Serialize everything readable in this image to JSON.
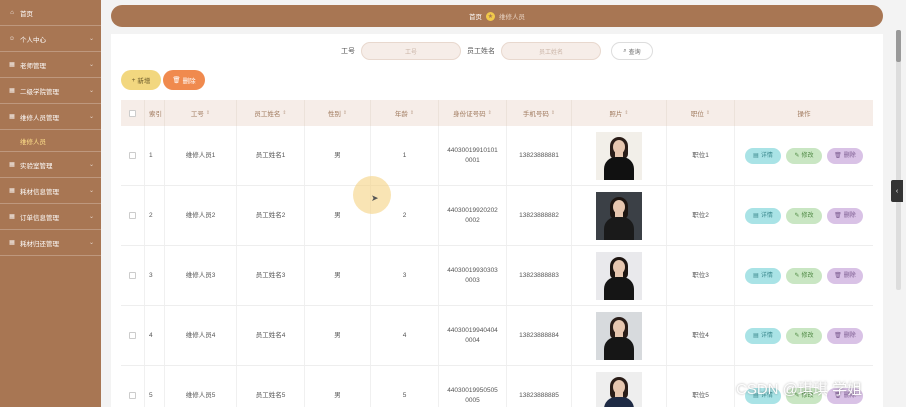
{
  "sidebar": {
    "items": [
      {
        "label": "首页",
        "icon": "home-icon",
        "arrow": false
      },
      {
        "label": "个人中心",
        "icon": "user-icon",
        "arrow": true
      },
      {
        "label": "老师管理",
        "icon": "grid-icon",
        "arrow": true
      },
      {
        "label": "二级学院管理",
        "icon": "grid-icon",
        "arrow": true
      },
      {
        "label": "维修人员管理",
        "icon": "grid-icon",
        "arrow": true
      },
      {
        "label": "实验室管理",
        "icon": "grid-icon",
        "arrow": true
      },
      {
        "label": "耗材信息管理",
        "icon": "grid-icon",
        "arrow": true
      },
      {
        "label": "订单信息管理",
        "icon": "grid-icon",
        "arrow": true
      },
      {
        "label": "耗材归还管理",
        "icon": "grid-icon",
        "arrow": true
      }
    ],
    "active_sub": "维修人员"
  },
  "breadcrumb": {
    "home": "首页",
    "current": "维修人员"
  },
  "search": {
    "label1": "工号",
    "placeholder1": "工号",
    "label2": "员工姓名",
    "placeholder2": "员工姓名",
    "button": "查询"
  },
  "actions": {
    "add": "新增",
    "delete": "删除"
  },
  "table": {
    "headers": [
      "索引",
      "工号",
      "员工姓名",
      "性别",
      "年龄",
      "身份证号码",
      "手机号码",
      "照片",
      "职位",
      "操作"
    ],
    "rows": [
      {
        "idx": "1",
        "gh": "维修人员1",
        "xm": "员工姓名1",
        "xb": "男",
        "nl": "1",
        "sf1": "44030019910101",
        "sf2": "0001",
        "sj": "13823888881",
        "zw": "职位1",
        "photo_bg": "#f2efe9",
        "photo_body": "#111111",
        "photo_hair": "#2a1d18"
      },
      {
        "idx": "2",
        "gh": "维修人员2",
        "xm": "员工姓名2",
        "xb": "男",
        "nl": "2",
        "sf1": "44030019920202",
        "sf2": "0002",
        "sj": "13823888882",
        "zw": "职位2",
        "photo_bg": "#3b4046",
        "photo_body": "#1a1a1a",
        "photo_hair": "#1e1612"
      },
      {
        "idx": "3",
        "gh": "维修人员3",
        "xm": "员工姓名3",
        "xb": "男",
        "nl": "3",
        "sf1": "44030019930303",
        "sf2": "0003",
        "sj": "13823888883",
        "zw": "职位3",
        "photo_bg": "#e9e9ec",
        "photo_body": "#151515",
        "photo_hair": "#1e1612"
      },
      {
        "idx": "4",
        "gh": "维修人员4",
        "xm": "员工姓名4",
        "xb": "男",
        "nl": "4",
        "sf1": "44030019940404",
        "sf2": "0004",
        "sj": "13823888884",
        "zw": "职位4",
        "photo_bg": "#d7dadd",
        "photo_body": "#161616",
        "photo_hair": "#2a1d18"
      },
      {
        "idx": "5",
        "gh": "维修人员5",
        "xm": "员工姓名5",
        "xb": "男",
        "nl": "5",
        "sf1": "44030019950505",
        "sf2": "0005",
        "sj": "13823888885",
        "zw": "职位5",
        "photo_bg": "#eeeeee",
        "photo_body": "#1e2a44",
        "photo_hair": "#2a1d18"
      }
    ],
    "ops": {
      "detail": "详情",
      "edit": "修改",
      "delete": "删除"
    }
  },
  "watermark": "CSDN @琪琪 学姐",
  "colors": {
    "sidebar": "#a87653",
    "header_bg": "#f6ede8",
    "detail": "#a9e3e6",
    "edit": "#c9e6c3",
    "remove": "#d9c2e6"
  }
}
